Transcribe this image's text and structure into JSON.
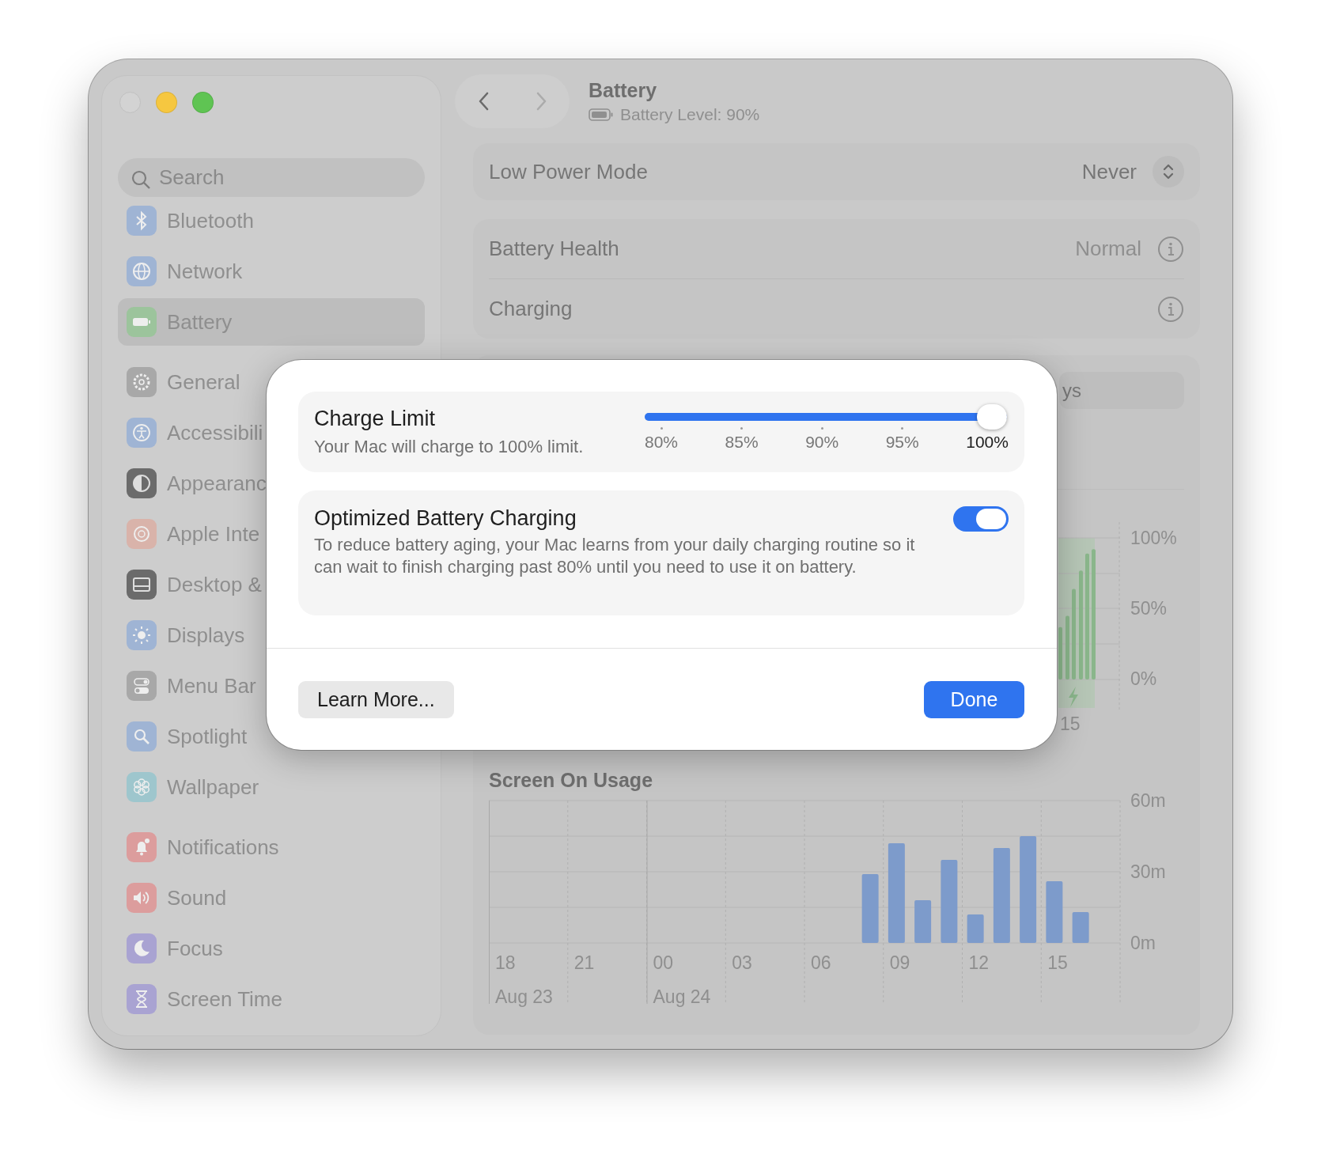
{
  "window": {
    "traffic_lights": [
      {
        "kind": "close",
        "disabled": true
      },
      {
        "kind": "minimize",
        "disabled": false
      },
      {
        "kind": "zoom",
        "disabled": false
      }
    ]
  },
  "sidebar": {
    "search": {
      "placeholder": "Search"
    },
    "groups": [
      {
        "items": [
          {
            "label": "Bluetooth",
            "selected": false
          },
          {
            "label": "Network",
            "selected": false
          },
          {
            "label": "Battery",
            "selected": true
          }
        ]
      },
      {
        "items": [
          {
            "label": "General",
            "selected": false
          },
          {
            "label": "Accessibili",
            "selected": false
          },
          {
            "label": "Appearanc",
            "selected": false
          },
          {
            "label": "Apple Inte",
            "selected": false
          },
          {
            "label": "Desktop &",
            "selected": false
          },
          {
            "label": "Displays",
            "selected": false
          },
          {
            "label": "Menu Bar",
            "selected": false
          },
          {
            "label": "Spotlight",
            "selected": false
          },
          {
            "label": "Wallpaper",
            "selected": false
          }
        ]
      },
      {
        "items": [
          {
            "label": "Notifications",
            "selected": false
          },
          {
            "label": "Sound",
            "selected": false
          },
          {
            "label": "Focus",
            "selected": false
          },
          {
            "label": "Screen Time",
            "selected": false
          }
        ]
      }
    ]
  },
  "toolbar": {
    "nav": [
      {
        "kind": "back",
        "disabled": false
      },
      {
        "kind": "forward",
        "disabled": true
      }
    ],
    "title": "Battery",
    "subtitle": "Battery Level: 90%"
  },
  "low_power_mode": {
    "label": "Low Power Mode",
    "value": "Never"
  },
  "status": {
    "rows": [
      {
        "label": "Battery Health",
        "value": "Normal"
      },
      {
        "label": "Charging"
      }
    ]
  },
  "usage": {
    "segment": {
      "label": "ys"
    },
    "battery_level": {
      "yticks": [
        "100%",
        "50%",
        "0%"
      ],
      "x_label": "15"
    },
    "screen_on_usage": {
      "title": "Screen On Usage",
      "dates": [
        "Aug 23",
        "Aug 24"
      ],
      "chart_data": {
        "type": "bar",
        "categories": [
          "18",
          null,
          null,
          "21",
          null,
          null,
          "00",
          null,
          null,
          "03",
          null,
          null,
          "06",
          null,
          null,
          "09",
          null,
          null,
          "12",
          null,
          null,
          "15",
          null,
          null
        ],
        "values": [
          0,
          0,
          0,
          0,
          0,
          0,
          0,
          0,
          0,
          0,
          0,
          0,
          0,
          0,
          29,
          42,
          18,
          35,
          12,
          40,
          45,
          26,
          13,
          0
        ],
        "ylim": [
          0,
          60
        ],
        "yticks": [
          {
            "value": 0,
            "label": "0m"
          },
          {
            "value": 30,
            "label": "30m"
          },
          {
            "value": 60,
            "label": "60m"
          }
        ]
      }
    }
  },
  "dialog": {
    "charge_limit": {
      "title": "Charge Limit",
      "description": "Your Mac will charge to 100% limit.",
      "level": 1,
      "ticks": [
        {
          "label": "80%",
          "selected": false
        },
        {
          "label": "85%",
          "selected": false
        },
        {
          "label": "90%",
          "selected": false
        },
        {
          "label": "95%",
          "selected": false
        },
        {
          "label": "100%",
          "selected": true
        }
      ]
    },
    "optimized": {
      "title": "Optimized Battery Charging",
      "description": "To reduce battery aging, your Mac learns from your daily charging routine so it can wait to finish charging past 80% until you need to use it on battery.",
      "on": true
    },
    "buttons": [
      {
        "label": "Learn More...",
        "kind": "secondary"
      },
      {
        "label": "Done",
        "kind": "primary"
      }
    ]
  }
}
